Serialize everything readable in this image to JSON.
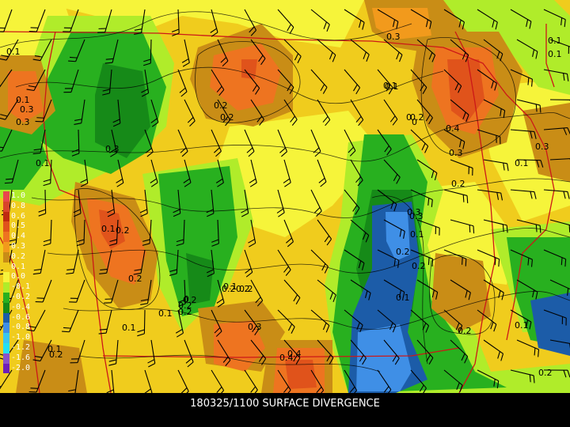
{
  "caption": "180325/1100 SURFACE DIVERGENCE",
  "legend": {
    "levels": [
      {
        "label": " 1.0",
        "color": "#e9474c"
      },
      {
        "label": " 0.8",
        "color": "#d9432a"
      },
      {
        "label": " 0.6",
        "color": "#bf2a10"
      },
      {
        "label": " 0.5",
        "color": "#e0531b"
      },
      {
        "label": " 0.4",
        "color": "#ee7420"
      },
      {
        "label": " 0.3",
        "color": "#f29a1c"
      },
      {
        "label": " 0.2",
        "color": "#c98d16"
      },
      {
        "label": " 0.1",
        "color": "#f0cc1d"
      },
      {
        "label": " 0.0",
        "color": "#f6f43a"
      },
      {
        "label": "-0.1",
        "color": "#b0ec2a"
      },
      {
        "label": "-0.2",
        "color": "#28b01f"
      },
      {
        "label": "-0.4",
        "color": "#168a18"
      },
      {
        "label": "-0.6",
        "color": "#1c5ca8"
      },
      {
        "label": "-0.8",
        "color": "#3f8fe6"
      },
      {
        "label": "-1.0",
        "color": "#39c6ef"
      },
      {
        "label": "-1.2",
        "color": "#24e0f0"
      },
      {
        "label": "-1.6",
        "color": "#8b52c8"
      },
      {
        "label": "-2.0",
        "color": "#6e1fb7"
      }
    ]
  },
  "contour_labels": [
    "0.1",
    "0.3",
    "0.1",
    "0.1",
    "0.3",
    "0.3",
    "0.2",
    "0.2",
    "0.4",
    "0.2",
    "0.1",
    "0.2",
    "0",
    "0.1",
    "0.1",
    "0.4",
    "0.3",
    "0.2",
    "0.1",
    "0.2",
    "0.3",
    "0.4",
    "0.2",
    "0.1",
    "0.2",
    "0.1",
    "0.3",
    "0.1",
    "0.2",
    "0.2",
    "0.3",
    "0.2",
    "0.2",
    "0.1",
    "0.3",
    "0.1",
    "0.2",
    "0.1",
    "0.2",
    "0.2",
    "0",
    "0.2",
    "0.1",
    "0.1",
    "0.3",
    "0",
    "0.1",
    "0.2"
  ]
}
